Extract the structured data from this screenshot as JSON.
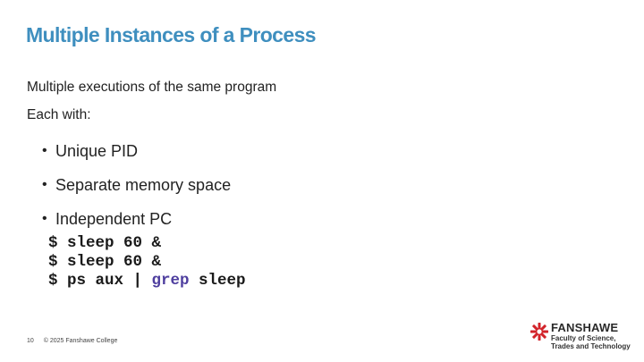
{
  "slide": {
    "title": "Multiple Instances of a Process",
    "intro": "Multiple executions of the same program",
    "each_with": "Each with:",
    "bullets": [
      "Unique PID",
      "Separate memory space",
      "Independent PC"
    ],
    "code": {
      "line1": {
        "prefix": "$ sleep 60 ",
        "op": "&"
      },
      "line2": {
        "prefix": "$ sleep 60 ",
        "op": "&"
      },
      "line3": {
        "prefix": "$ ps aux | ",
        "kw": "grep",
        "suffix": " sleep"
      }
    }
  },
  "footer": {
    "page_number": "10",
    "copyright": "© 2025 Fanshawe College"
  },
  "logo": {
    "brand": "FANSHAWE",
    "line1": "Faculty of Science,",
    "line2": "Trades and Technology",
    "icon": "fanshawe-star-icon",
    "color": "#d2232a"
  },
  "colors": {
    "title": "#3f8fbf",
    "keyword": "#4f3f9f"
  }
}
